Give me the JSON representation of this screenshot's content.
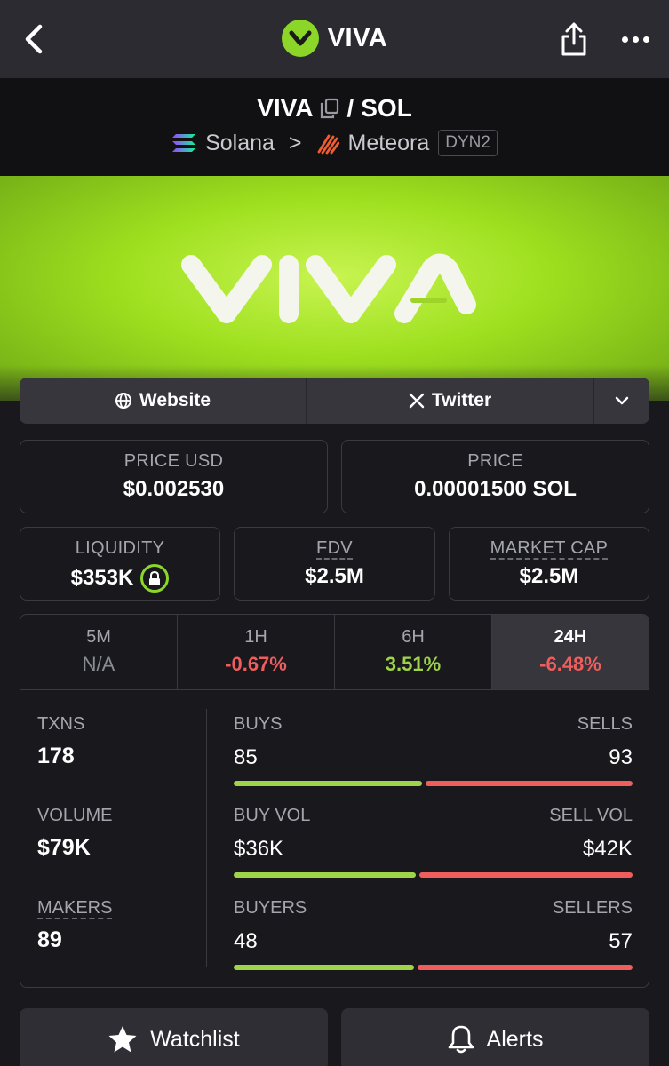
{
  "topbar": {
    "title": "VIVA"
  },
  "pair": {
    "base": "VIVA",
    "separator": "/",
    "quote": "SOL",
    "chain": "Solana",
    "chevron": ">",
    "dex": "Meteora",
    "badge": "DYN2"
  },
  "links": {
    "website": "Website",
    "twitter": "Twitter"
  },
  "stats": {
    "price_usd": {
      "label": "PRICE USD",
      "value": "$0.002530"
    },
    "price": {
      "label": "PRICE",
      "value": "0.00001500 SOL"
    },
    "liquidity": {
      "label": "LIQUIDITY",
      "value": "$353K"
    },
    "fdv": {
      "label": "FDV",
      "value": "$2.5M"
    },
    "market_cap": {
      "label": "MARKET CAP",
      "value": "$2.5M"
    }
  },
  "tabs": [
    {
      "label": "5M",
      "value": "N/A"
    },
    {
      "label": "1H",
      "value": "-0.67%"
    },
    {
      "label": "6H",
      "value": "3.51%"
    },
    {
      "label": "24H",
      "value": "-6.48%"
    }
  ],
  "txn_stats": {
    "txns": {
      "label": "TXNS",
      "value": "178"
    },
    "volume": {
      "label": "VOLUME",
      "value": "$79K"
    },
    "makers": {
      "label": "MAKERS",
      "value": "89"
    },
    "buys": {
      "left_label": "BUYS",
      "right_label": "SELLS",
      "left_value": "85",
      "right_value": "93",
      "left_fraction": 0.477
    },
    "vol": {
      "left_label": "BUY VOL",
      "right_label": "SELL VOL",
      "left_value": "$36K",
      "right_value": "$42K",
      "left_fraction": 0.46
    },
    "buyers": {
      "left_label": "BUYERS",
      "right_label": "SELLERS",
      "left_value": "48",
      "right_value": "57",
      "left_fraction": 0.457
    }
  },
  "bottom": {
    "watchlist": "Watchlist",
    "alerts": "Alerts"
  },
  "colors": {
    "accent": "#8bd629",
    "positive": "#9ed34a",
    "negative": "#f05d5d"
  }
}
